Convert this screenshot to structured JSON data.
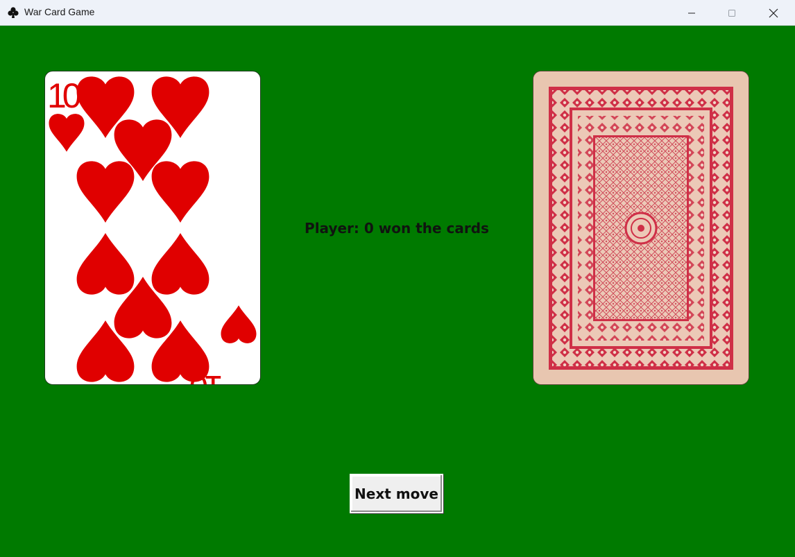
{
  "window": {
    "title": "War Card Game",
    "icon": "club-suit-icon",
    "controls": [
      "minimize-icon",
      "maximize-icon",
      "close-icon"
    ]
  },
  "table": {
    "background_color": "#007a00",
    "status_text": "Player: 0 won the cards"
  },
  "cards": {
    "player": {
      "rank": "10",
      "suit": "hearts",
      "suit_color": "#e00000",
      "face_up": true
    },
    "opponent": {
      "face_up": false,
      "back_color": "#d23a4a"
    }
  },
  "controls": {
    "next_move_label": "Next move"
  }
}
